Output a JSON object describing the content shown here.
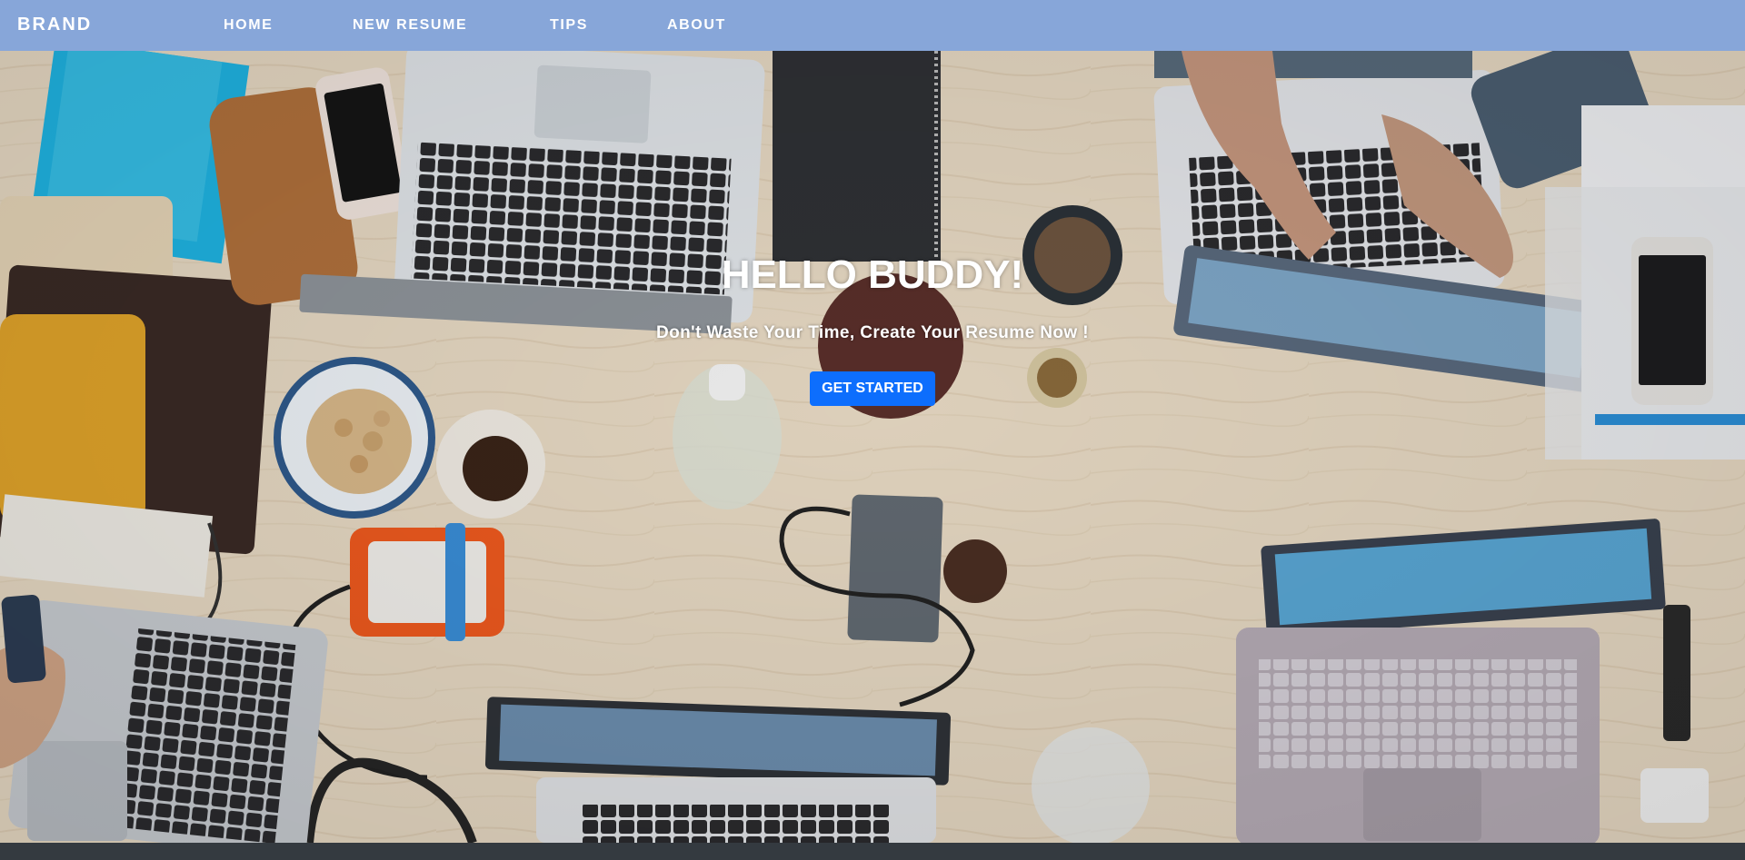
{
  "navbar": {
    "brand": "BRAND",
    "links": [
      {
        "label": "HOME"
      },
      {
        "label": "NEW RESUME"
      },
      {
        "label": "TIPS"
      },
      {
        "label": "ABOUT"
      }
    ],
    "background": "#87a6d9"
  },
  "hero": {
    "title": "HELLO BUDDY!",
    "subtitle": "Don't Waste Your Time, Create Your Resume Now !",
    "cta_label": "GET STARTED",
    "cta_color": "#0d6efd"
  },
  "footer": {
    "background": "#343a40"
  }
}
